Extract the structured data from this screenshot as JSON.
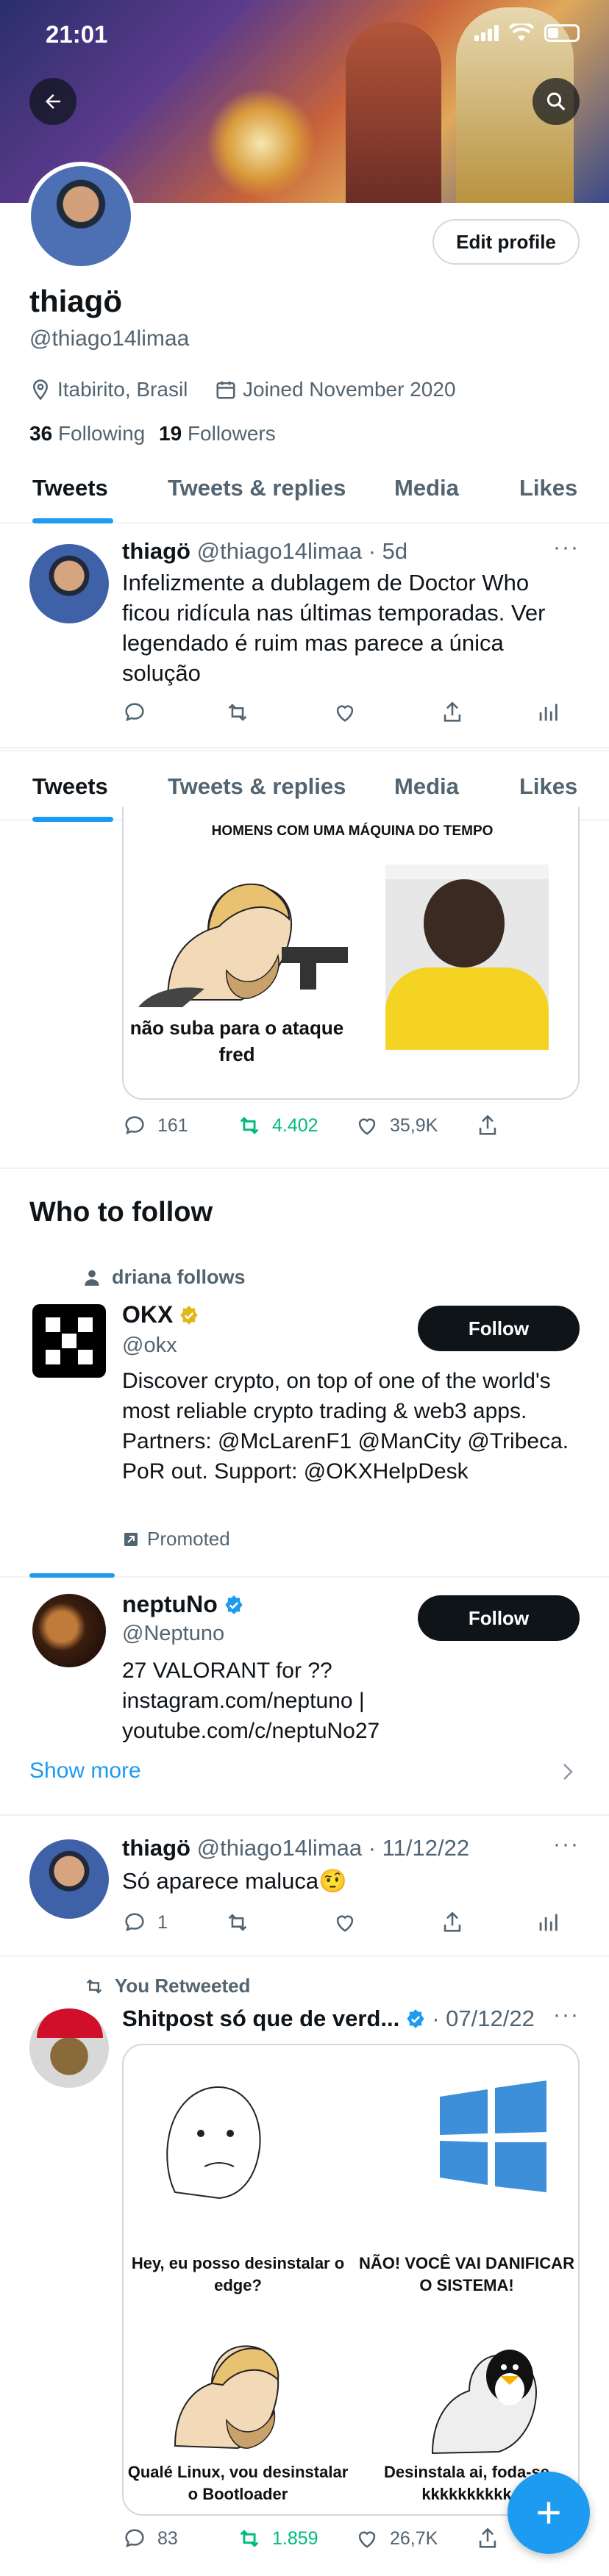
{
  "status_bar": {
    "time": "21:01"
  },
  "profile": {
    "display_name": "thiagö",
    "handle": "@thiago14limaa",
    "location": "Itabirito, Brasil",
    "joined": "Joined November 2020",
    "following_count": "36",
    "following_label": "Following",
    "followers_count": "19",
    "followers_label": "Followers",
    "edit_button": "Edit profile"
  },
  "tabs": [
    "Tweets",
    "Tweets & replies",
    "Media",
    "Likes"
  ],
  "tweet1": {
    "name": "thiagö",
    "handle": "@thiago14limaa",
    "time": "· 5d",
    "text": "Infelizmente a dublagem de Doctor Who ficou ridícula nas últimas temporadas. Ver legendado é ruim mas parece a única solução"
  },
  "tweet2": {
    "meme_title": "HOMENS COM UMA MÁQUINA DO TEMPO",
    "meme_caption": "não suba para o ataque fred",
    "replies": "161",
    "retweets": "4.402",
    "likes": "35,9K"
  },
  "who_to_follow": {
    "title": "Who to follow",
    "suggestions": [
      {
        "context": "driana follows",
        "name": "OKX",
        "handle": "@okx",
        "bio": "Discover crypto, on top of one of the world's most reliable crypto trading & web3 apps. Partners: @McLarenF1 @ManCity @Tribeca. PoR out. Support: @OKXHelpDesk",
        "promoted": "Promoted",
        "follow": "Follow"
      },
      {
        "name": "neptuNo",
        "handle": "@Neptuno",
        "bio": "27 VALORANT for ?? instagram.com/neptuno | youtube.com/c/neptuNo27",
        "follow": "Follow"
      }
    ],
    "show_more": "Show more"
  },
  "tweet3": {
    "name": "thiagö",
    "handle": "@thiago14limaa",
    "time": "· 11/12/22",
    "text": "Só aparece maluca🤨",
    "replies": "1"
  },
  "tweet4": {
    "context": "You Retweeted",
    "name": "Shitpost só que de verd...",
    "time": "· 07/12/22",
    "panels": [
      "Hey, eu posso desinstalar o edge?",
      "NÃO! VOCÊ VAI DANIFICAR O SISTEMA!",
      "Qualé Linux, vou desinstalar o Bootloader",
      "Desinstala ai, foda-se kkkkkkkkkk"
    ],
    "replies": "83",
    "retweets": "1.859",
    "likes": "26,7K"
  },
  "colors": {
    "accent": "#1d9bf0",
    "retweet_green": "#00ba7c",
    "verified_gold": "#e2b719"
  }
}
